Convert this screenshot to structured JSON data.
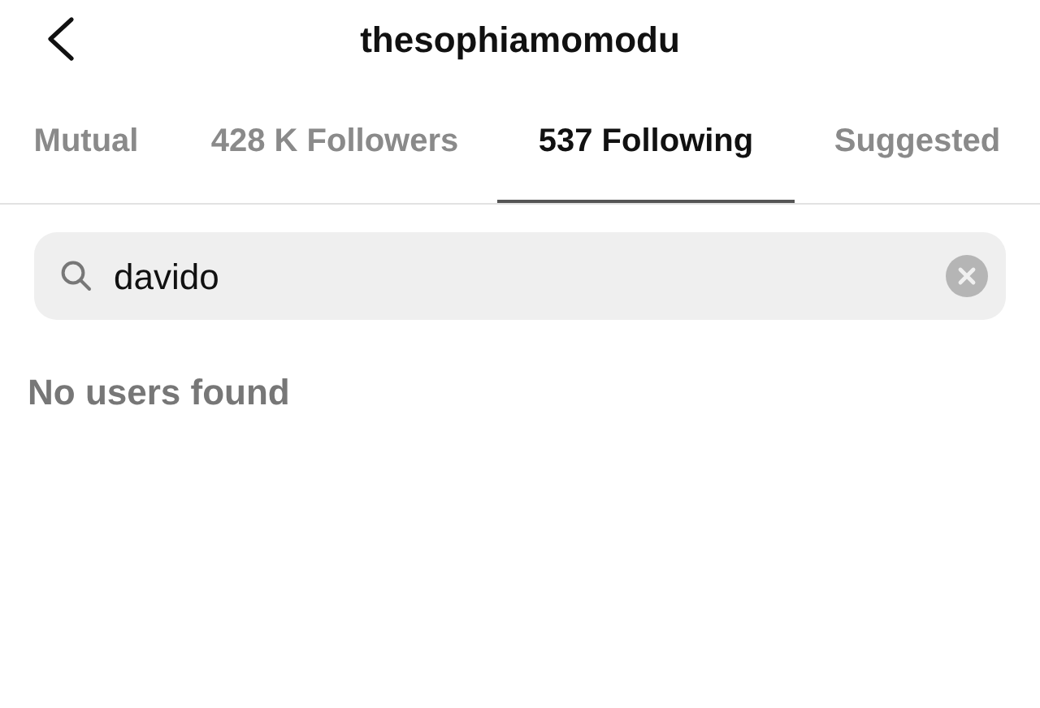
{
  "header": {
    "title": "thesophiamomodu"
  },
  "tabs": [
    {
      "label": "Mutual",
      "selected": false
    },
    {
      "label": "428 K Followers",
      "selected": false
    },
    {
      "label": "537 Following",
      "selected": true
    },
    {
      "label": "Suggested",
      "selected": false
    }
  ],
  "search": {
    "value": "davido"
  },
  "message": "No users found"
}
